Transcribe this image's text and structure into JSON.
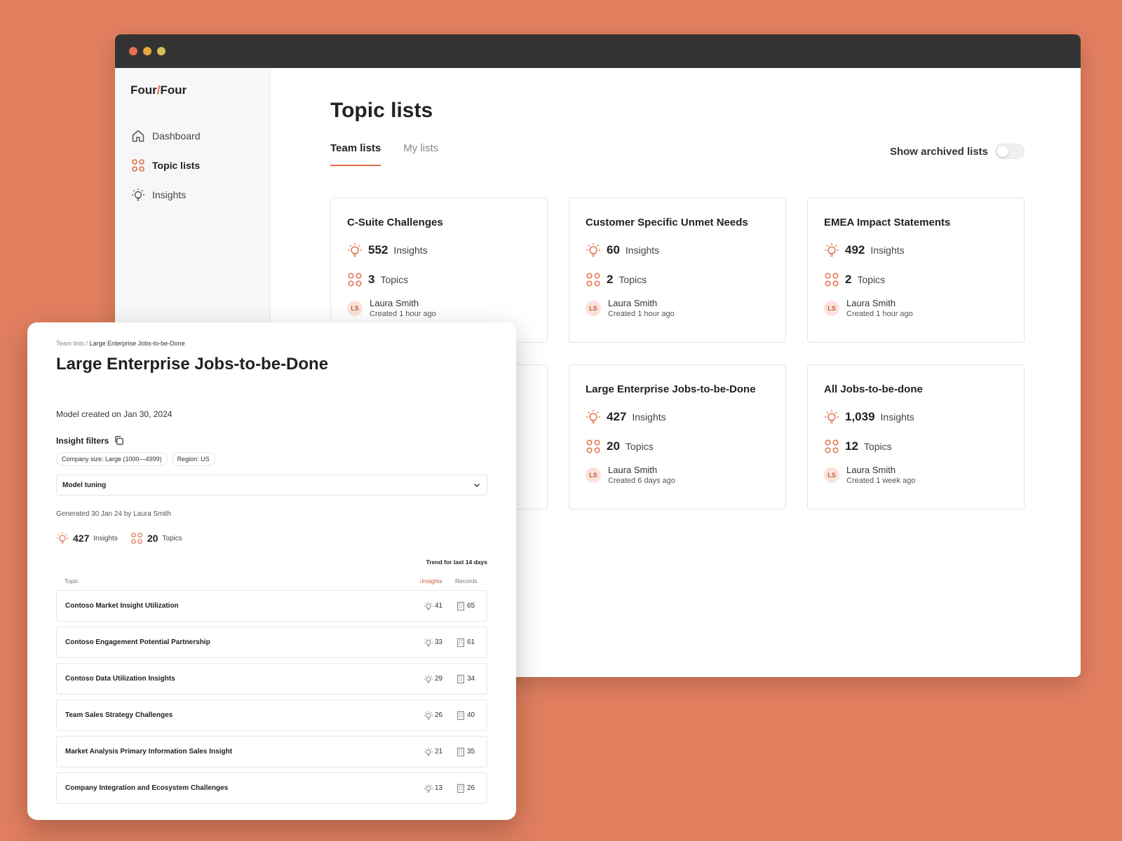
{
  "colors": {
    "accent": "#E06B45",
    "background": "#E17F5F",
    "titlebar": "#333333"
  },
  "window": {
    "dots": [
      "#E8704F",
      "#E9A83E",
      "#D6C25A"
    ]
  },
  "brand": {
    "part1": "Four",
    "slash": "/",
    "part2": "Four"
  },
  "sidebar": {
    "items": [
      {
        "label": "Dashboard",
        "icon": "home-icon"
      },
      {
        "label": "Topic lists",
        "icon": "grid-icon"
      },
      {
        "label": "Insights",
        "icon": "lightbulb-icon"
      }
    ]
  },
  "main": {
    "title": "Topic lists",
    "tabs": [
      {
        "label": "Team lists"
      },
      {
        "label": "My lists"
      }
    ],
    "archived_label": "Show archived lists",
    "archived_on": false,
    "insights_label": "Insights",
    "topics_label": "Topics",
    "cards": [
      {
        "title": "C-Suite Challenges",
        "insights": "552",
        "topics": "3",
        "initials": "LS",
        "owner": "Laura Smith",
        "created": "Created 1 hour ago"
      },
      {
        "title": "Customer Specific Unmet Needs",
        "insights": "60",
        "topics": "2",
        "initials": "LS",
        "owner": "Laura Smith",
        "created": "Created 1 hour ago"
      },
      {
        "title": "EMEA Impact Statements",
        "insights": "492",
        "topics": "2",
        "initials": "LS",
        "owner": "Laura Smith",
        "created": "Created 1 hour ago"
      },
      {
        "title": "Large Enterprise Jobs-to-be-Done",
        "insights": "427",
        "topics": "20",
        "initials": "LS",
        "owner": "Laura Smith",
        "created": "Created 6 days ago"
      },
      {
        "title": "All Jobs-to-be-done",
        "insights": "1,039",
        "topics": "12",
        "initials": "LS",
        "owner": "Laura Smith",
        "created": "Created 1 week ago"
      }
    ]
  },
  "panel": {
    "breadcrumb": {
      "parent": "Team lists",
      "separator": "/",
      "current": "Large Enterprise Jobs-to-be-Done"
    },
    "title": "Large Enterprise Jobs-to-be-Done",
    "model_created": "Model created on Jan 30, 2024",
    "filters_label": "Insight filters",
    "chips": [
      "Company size: Large (1000—4999)",
      "Region: US"
    ],
    "tuning_label": "Model tuning",
    "generated": "Generated 30 Jan 24 by Laura Smith",
    "insights_count": "427",
    "insights_label": "Insights",
    "topics_count": "20",
    "topics_label": "Topics",
    "trend_label": "Trend for last 14 days",
    "columns": {
      "topic": "Topic",
      "insights": "Insights",
      "records": "Records"
    },
    "rows": [
      {
        "name": "Contoso Market Insight Utilization",
        "insights": "41",
        "records": "65"
      },
      {
        "name": "Contoso Engagement Potential Partnership",
        "insights": "33",
        "records": "61"
      },
      {
        "name": "Contoso Data Utilization Insights",
        "insights": "29",
        "records": "34"
      },
      {
        "name": "Team Sales Strategy Challenges",
        "insights": "26",
        "records": "40"
      },
      {
        "name": "Market Analysis Primary Information Sales Insight",
        "insights": "21",
        "records": "35"
      },
      {
        "name": "Company Integration and Ecosystem Challenges",
        "insights": "13",
        "records": "26"
      }
    ]
  }
}
